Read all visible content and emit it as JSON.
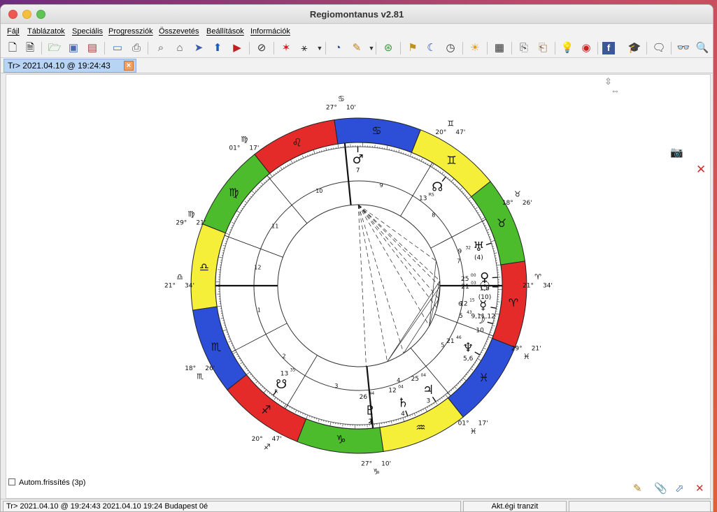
{
  "window": {
    "title": "Regiomontanus v2.81"
  },
  "menu": {
    "items": [
      "Fájl",
      "Táblázatok",
      "Speciális",
      "Progressziók",
      "Összevetés",
      "Beállítások",
      "Információk"
    ]
  },
  "toolbar": {
    "icons": [
      "new-document-icon",
      "page-icon",
      "open-folder-icon",
      "save-icon",
      "save-all-icon",
      "photo-icon",
      "print-icon",
      "telescope-icon",
      "home-icon",
      "cursor-icon",
      "up-arrow-icon",
      "play-icon",
      "hide-icon",
      "stars-icon",
      "aspect-icon",
      "clock-dial-icon",
      "tools-icon",
      "circles-icon",
      "signpost-icon",
      "moon-icon",
      "time-icon",
      "sun-icon",
      "calendar-icon",
      "export-icon",
      "import-icon",
      "lightbulb-icon",
      "help-icon",
      "facebook-icon",
      "graduation-icon",
      "comment-icon",
      "glasses-icon",
      "search-icon"
    ]
  },
  "tab": {
    "label": "Tr> 2021.04.10 @ 19:24:43"
  },
  "autom": {
    "label": "Autom.frissítés (3p)"
  },
  "status": {
    "left": "Tr> 2021.04.10 @ 19:24:43 2021.04.10 19:24 Budapest   0é",
    "mode": "Akt.égi tranzit",
    "empty": ""
  },
  "chart_data": {
    "type": "horoscope",
    "zodiac_ring": [
      {
        "sign": "♈",
        "color": "#e52a2a"
      },
      {
        "sign": "♉",
        "color": "#4cbc2c"
      },
      {
        "sign": "♊",
        "color": "#f5ef3a"
      },
      {
        "sign": "♋",
        "color": "#2d4fd8"
      },
      {
        "sign": "♌",
        "color": "#e52a2a"
      },
      {
        "sign": "♍",
        "color": "#4cbc2c"
      },
      {
        "sign": "♎",
        "color": "#f5ef3a"
      },
      {
        "sign": "♏",
        "color": "#2d4fd8"
      },
      {
        "sign": "♐",
        "color": "#e52a2a"
      },
      {
        "sign": "♑",
        "color": "#4cbc2c"
      },
      {
        "sign": "♒",
        "color": "#f5ef3a"
      },
      {
        "sign": "♓",
        "color": "#2d4fd8"
      }
    ],
    "ascendant_longitude": 201.57,
    "house_cusps": [
      201.57,
      229.2,
      260.7,
      297.2,
      331.3,
      1.0,
      21.57,
      49.2,
      80.7,
      117.2,
      151.3,
      181.0
    ],
    "house_numbers": [
      "1",
      "2",
      "3",
      "4",
      "5",
      "6",
      "7",
      "8",
      "9",
      "10",
      "11",
      "12"
    ],
    "cusp_labels": [
      {
        "deg": "21°",
        "sign": "♎",
        "min": "34'"
      },
      {
        "deg": "18°",
        "sign": "♏",
        "min": "26'"
      },
      {
        "deg": "20°",
        "sign": "♐",
        "min": "47'"
      },
      {
        "deg": "27°",
        "sign": "♑",
        "min": "10'"
      },
      {
        "deg": "01°",
        "sign": "♓",
        "min": "17'"
      },
      {
        "deg": "29°",
        "sign": "♓",
        "min": "21'"
      },
      {
        "deg": "21°",
        "sign": "♈",
        "min": "34'"
      },
      {
        "deg": "18°",
        "sign": "♉",
        "min": "26'"
      },
      {
        "deg": "20°",
        "sign": "♊",
        "min": "47'"
      },
      {
        "deg": "27°",
        "sign": "♋",
        "min": "10'"
      },
      {
        "deg": "01°",
        "sign": "♍",
        "min": "17'"
      },
      {
        "deg": "29°",
        "sign": "♍",
        "min": "21'"
      }
    ],
    "planets": [
      {
        "symbol": "♂",
        "lon": 112.0,
        "degree": "",
        "sup": "",
        "rulers": "7"
      },
      {
        "symbol": "☊",
        "lon": 73.0,
        "degree": "13",
        "sup": "RS",
        "rulers": ""
      },
      {
        "symbol": "♅",
        "lon": 39.4,
        "degree": "9",
        "sup": "32",
        "rulers": "(4)"
      },
      {
        "symbol": "♀",
        "lon": 25.0,
        "degree": "25",
        "sup": "00",
        "rulers": "1,8"
      },
      {
        "symbol": "☉",
        "lon": 21.05,
        "degree": "21",
        "sup": "03",
        "rulers": "(10)"
      },
      {
        "symbol": "☿",
        "lon": 12.25,
        "degree": "12",
        "sup": "15",
        "rulers": "9,11,12"
      },
      {
        "symbol": "☽",
        "lon": 5.72,
        "degree": "5",
        "sup": "43",
        "rulers": "10"
      },
      {
        "symbol": "♆",
        "lon": 351.77,
        "degree": "21",
        "sup": "46",
        "rulers": "5,6"
      },
      {
        "symbol": "♃",
        "lon": 325.07,
        "degree": "25",
        "sup": "04",
        "rulers": "3"
      },
      {
        "symbol": "♄",
        "lon": 312.07,
        "degree": "12",
        "sup": "04",
        "rulers": "4"
      },
      {
        "symbol": "♇",
        "lon": 296.73,
        "degree": "26",
        "sup": "44",
        "rulers": "2"
      },
      {
        "symbol": "☋",
        "lon": 253.58,
        "degree": "13",
        "sup": "35",
        "rulers": ""
      }
    ],
    "retro_mark": "R",
    "extra_cusp_text": {
      "mc_min": "10'",
      "lon22": "22",
      "lon22sup": "17"
    }
  }
}
